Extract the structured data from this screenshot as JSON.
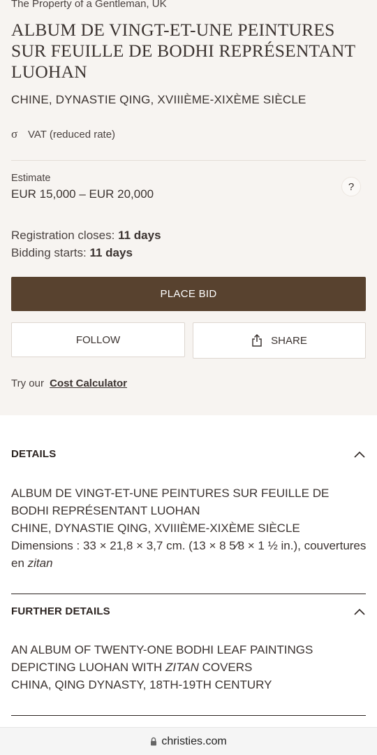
{
  "lot": {
    "provenance": "The Property of a Gentleman, UK",
    "title": "ALBUM DE VINGT-ET-UNE PEINTURES SUR FEUILLE DE BODHI REPRÉSENTANT LUOHAN",
    "subtitle": "CHINE, DYNASTIE QING, XVIIIÈME-XIXÈME SIÈCLE",
    "vat_symbol": "σ",
    "vat_label": "VAT (reduced rate)",
    "estimate_label": "Estimate",
    "estimate_value": "EUR 15,000 – EUR 20,000",
    "help_label": "?",
    "registration_label": "Registration closes:",
    "registration_value": "11 days",
    "bidding_label": "Bidding starts:",
    "bidding_value": "11 days"
  },
  "actions": {
    "place_bid": "PLACE BID",
    "follow": "FOLLOW",
    "share": "SHARE",
    "calc_prefix": "Try our",
    "calc_link": "Cost Calculator"
  },
  "details": {
    "heading": "DETAILS",
    "line1": "ALBUM DE VINGT-ET-UNE PEINTURES SUR FEUILLE DE BODHI REPRÉSENTANT LUOHAN",
    "line2": "CHINE, DYNASTIE QING, XVIIIÈME-XIXÈME SIÈCLE",
    "dimensions": "Dimensions : 33 × 21,8 × 3,7 cm. (13 × 8 5⁄8 × 1 ½ in.), couvertures en ",
    "dimensions_italic": "zitan"
  },
  "further_details": {
    "heading": "FURTHER DETAILS",
    "line1_pre": "AN ALBUM OF TWENTY-ONE BODHI LEAF PAINTINGS DEPICTING LUOHAN WITH ",
    "line1_italic": "ZITAN",
    "line1_post": " COVERS",
    "line2": "CHINA, QING DYNASTY, 18TH-19TH CENTURY"
  },
  "browser": {
    "url": "christies.com"
  }
}
